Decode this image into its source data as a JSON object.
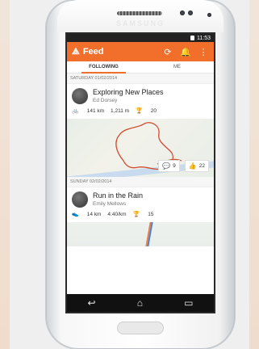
{
  "device": {
    "brand": "SAMSUNG"
  },
  "status_bar": {
    "time": "11:53"
  },
  "app_bar": {
    "logo_icon": "strava-logo-icon",
    "title": "Feed",
    "icons": [
      "refresh-icon",
      "notifications-icon",
      "more-vert-icon"
    ]
  },
  "tabs": [
    {
      "label": "FOLLOWING",
      "active": true
    },
    {
      "label": "ME",
      "active": false
    }
  ],
  "feed": [
    {
      "date": "SATURDAY 01/02/2014",
      "title": "Exploring New Places",
      "athlete": "Ed Dorsey",
      "activity_icon": "bike-icon",
      "stats": [
        "141 km",
        "1,211 m",
        "20"
      ],
      "comments": "9",
      "likes": "22"
    },
    {
      "date": "SUNDAY 02/02/2014",
      "title": "Run in the Rain",
      "athlete": "Emily Mellows",
      "activity_icon": "run-shoe-icon",
      "stats": [
        "14 km",
        "4:40/km",
        "15"
      ]
    }
  ],
  "nav": {
    "icons": [
      "back-icon",
      "home-icon",
      "recent-apps-icon"
    ]
  },
  "colors": {
    "accent": "#f26e2b",
    "route": "#d24a2e",
    "nav_bg": "#111111"
  }
}
